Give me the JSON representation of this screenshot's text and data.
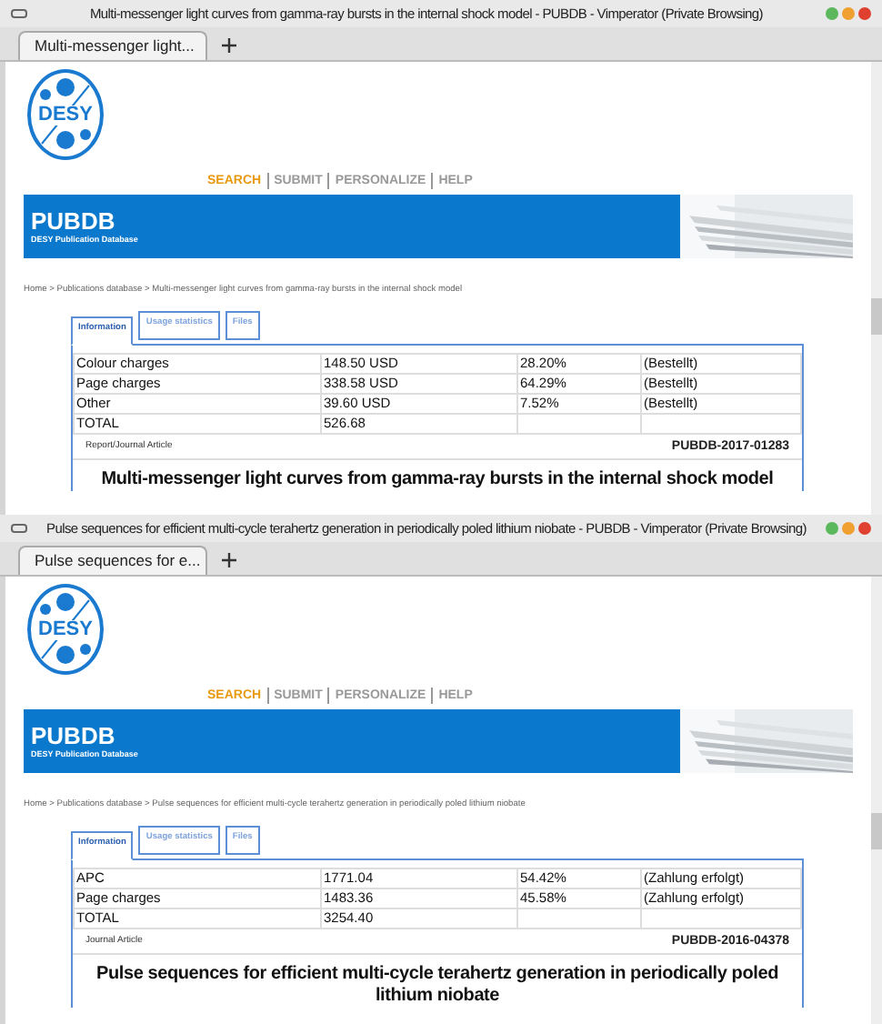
{
  "windows": [
    {
      "title": "Multi-messenger light curves from gamma-ray bursts in the internal shock model - PUBDB - Vimperator (Private Browsing)",
      "tab": "Multi-messenger light...",
      "logo": "DESY",
      "nav": [
        {
          "label": "SEARCH",
          "selected": true
        },
        {
          "label": "SUBMIT",
          "selected": false
        },
        {
          "label": "PERSONALIZE",
          "selected": false
        },
        {
          "label": "HELP",
          "selected": false
        }
      ],
      "banner": {
        "title": "PUBDB",
        "subtitle": "DESY Publication Database"
      },
      "breadcrumb": "Home > Publications database > Multi-messenger light curves from gamma-ray bursts in the internal shock model",
      "tabs": [
        {
          "label": "Information",
          "selected": true
        },
        {
          "label": "Usage statistics",
          "selected": false
        },
        {
          "label": "Files",
          "selected": false
        }
      ],
      "rows": [
        [
          "Colour charges",
          "148.50 USD",
          "28.20%",
          "(Bestellt)"
        ],
        [
          "Page charges",
          "338.58 USD",
          "64.29%",
          "(Bestellt)"
        ],
        [
          "Other",
          "39.60 USD",
          "7.52%",
          "(Bestellt)"
        ],
        [
          "TOTAL",
          "526.68"
        ]
      ],
      "type": "Report/Journal Article",
      "id": "PUBDB-2017-01283",
      "heading": "Multi-messenger light curves from gamma-ray bursts in the internal shock model"
    },
    {
      "title": "Pulse sequences for efficient multi-cycle terahertz generation in periodically poled lithium niobate - PUBDB - Vimperator (Private Browsing)",
      "tab": "Pulse sequences for e...",
      "logo": "DESY",
      "nav": [
        {
          "label": "SEARCH",
          "selected": true
        },
        {
          "label": "SUBMIT",
          "selected": false
        },
        {
          "label": "PERSONALIZE",
          "selected": false
        },
        {
          "label": "HELP",
          "selected": false
        }
      ],
      "banner": {
        "title": "PUBDB",
        "subtitle": "DESY Publication Database"
      },
      "breadcrumb": "Home > Publications database > Pulse sequences for efficient multi-cycle terahertz generation in periodically poled lithium niobate",
      "tabs": [
        {
          "label": "Information",
          "selected": true
        },
        {
          "label": "Usage statistics",
          "selected": false
        },
        {
          "label": "Files",
          "selected": false
        }
      ],
      "rows": [
        [
          "APC",
          "1771.04",
          "54.42%",
          "(Zahlung erfolgt)"
        ],
        [
          "Page charges",
          "1483.36",
          "45.58%",
          "(Zahlung erfolgt)"
        ],
        [
          "TOTAL",
          "3254.40"
        ]
      ],
      "type": "Journal Article",
      "id": "PUBDB-2016-04378",
      "heading": "Pulse sequences for efficient multi-cycle terahertz generation in periodically poled lithium niobate"
    }
  ]
}
